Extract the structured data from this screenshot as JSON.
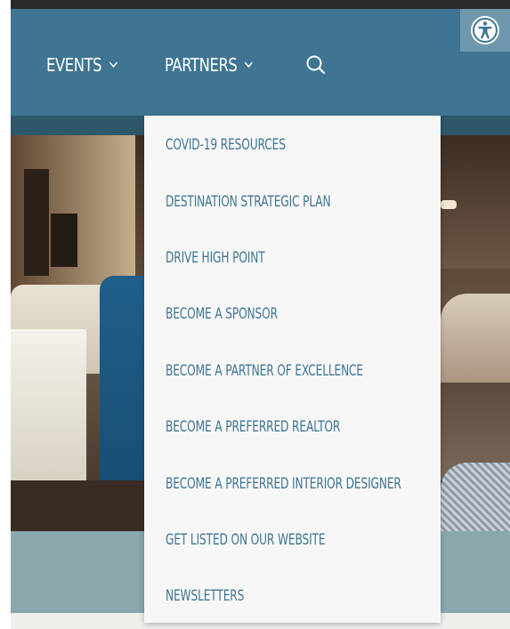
{
  "nav": {
    "events_label": "EVENTS",
    "partners_label": "PARTNERS",
    "chevron": "⌄",
    "search_icon": "search-icon",
    "accessibility_icon": "accessibility-icon"
  },
  "dropdown": {
    "items": [
      {
        "label": "COVID-19 RESOURCES"
      },
      {
        "label": "DESTINATION STRATEGIC PLAN"
      },
      {
        "label": "DRIVE HIGH POINT"
      },
      {
        "label": "BECOME A SPONSOR"
      },
      {
        "label": "BECOME A PARTNER OF EXCELLENCE"
      },
      {
        "label": "BECOME A PREFERRED REALTOR"
      },
      {
        "label": "BECOME A PREFERRED INTERIOR DESIGNER"
      },
      {
        "label": "GET LISTED ON OUR WEBSITE"
      },
      {
        "label": "NEWSLETTERS"
      }
    ]
  },
  "colors": {
    "nav_bg": "#3f7592",
    "dropdown_text": "#3f7592",
    "dropdown_bg": "#f7f7f7",
    "band": "#8aa7ae"
  }
}
